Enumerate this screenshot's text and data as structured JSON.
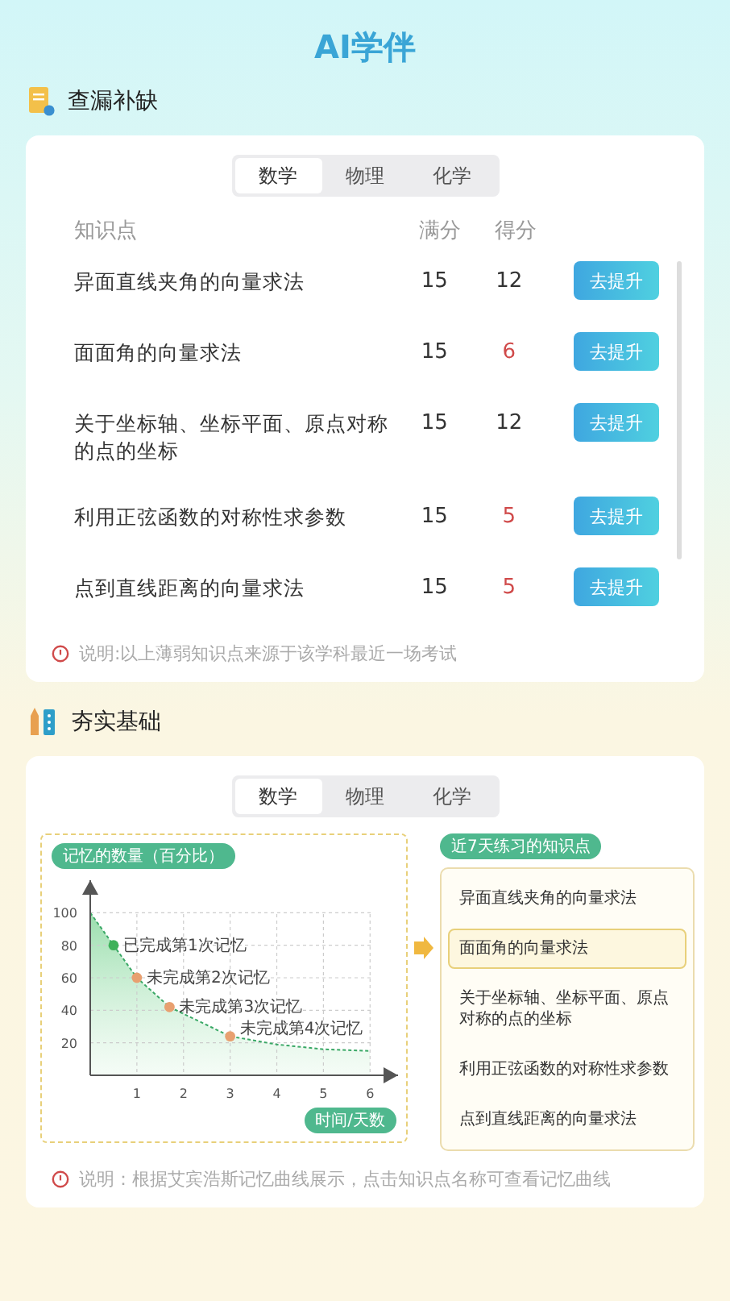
{
  "app_title": "AI学伴",
  "gap_check": {
    "title": "查漏补缺",
    "tabs": [
      {
        "label": "数学",
        "selected": true
      },
      {
        "label": "物理",
        "selected": false
      },
      {
        "label": "化学",
        "selected": false
      }
    ],
    "columns": [
      "知识点",
      "满分",
      "得分"
    ],
    "rows": [
      {
        "topic": "异面直线夹角的向量求法",
        "full": "15",
        "score": "12",
        "low": false,
        "action": "去提升"
      },
      {
        "topic": "面面角的向量求法",
        "full": "15",
        "score": "6",
        "low": true,
        "action": "去提升"
      },
      {
        "topic": "关于坐标轴、坐标平面、原点对称的点的坐标",
        "full": "15",
        "score": "12",
        "low": false,
        "action": "去提升"
      },
      {
        "topic": "利用正弦函数的对称性求参数",
        "full": "15",
        "score": "5",
        "low": true,
        "action": "去提升"
      },
      {
        "topic": "点到直线距离的向量求法",
        "full": "15",
        "score": "5",
        "low": true,
        "action": "去提升"
      }
    ],
    "note": "说明:以上薄弱知识点来源于该学科最近一场考试"
  },
  "foundation": {
    "title": "夯实基础",
    "tabs": [
      {
        "label": "数学",
        "selected": true
      },
      {
        "label": "物理",
        "selected": false
      },
      {
        "label": "化学",
        "selected": false
      }
    ],
    "chart_data": {
      "type": "area",
      "grid": true,
      "xlim": [
        0,
        6.6
      ],
      "ylim": [
        0,
        120
      ],
      "ylabel": "记忆的数量（百分比）",
      "xlabel": "时间/天数",
      "x": [
        0,
        0.5,
        1,
        1.7,
        3,
        4,
        5,
        6
      ],
      "series": [
        {
          "color": "#3aa866",
          "line_style": "dashed",
          "values": [
            100,
            80,
            60,
            42,
            24,
            19,
            16,
            15
          ]
        }
      ],
      "xticks": [
        1,
        2,
        3,
        4,
        5,
        6
      ],
      "yticks": [
        20,
        40,
        60,
        80,
        100
      ],
      "annotations": [
        {
          "x": 0.5,
          "y": 80,
          "text": "已完成第1次记忆"
        },
        {
          "x": 1,
          "y": 60,
          "text": "未完成第2次记忆"
        },
        {
          "x": 1.7,
          "y": 42,
          "text": "未完成第3次记忆"
        },
        {
          "x": 3,
          "y": 24,
          "text": "未完成第4次记忆"
        }
      ]
    },
    "memory_points": [
      {
        "color": "#3fb15a"
      },
      {
        "color": "#e8a070"
      },
      {
        "color": "#e8a070"
      },
      {
        "color": "#e8a070"
      }
    ],
    "list_tag": "近7天练习的知识点",
    "topics": [
      {
        "label": "异面直线夹角的向量求法",
        "selected": false
      },
      {
        "label": "面面角的向量求法",
        "selected": true
      },
      {
        "label": "关于坐标轴、坐标平面、原点对称的点的坐标",
        "selected": false
      },
      {
        "label": "利用正弦函数的对称性求参数",
        "selected": false
      },
      {
        "label": "点到直线距离的向量求法",
        "selected": false
      }
    ],
    "note": "说明：根据艾宾浩斯记忆曲线展示，点击知识点名称可查看记忆曲线"
  }
}
